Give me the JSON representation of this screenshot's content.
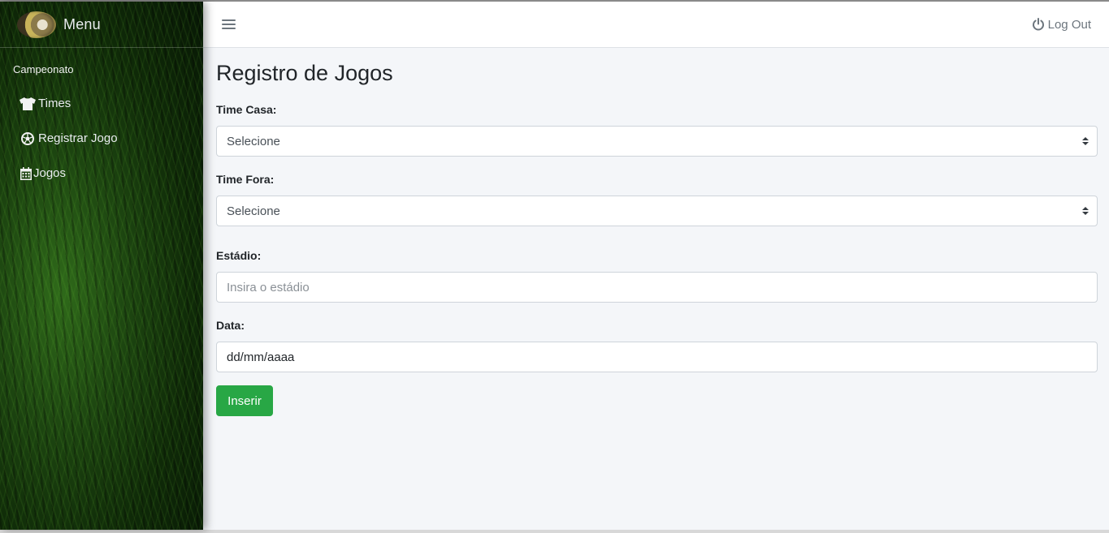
{
  "brand": {
    "title": "Menu"
  },
  "sidebar": {
    "header": "Campeonato",
    "items": [
      {
        "label": "Times",
        "icon": "tshirt-icon"
      },
      {
        "label": "Registrar Jogo",
        "icon": "futbol-icon"
      },
      {
        "label": "Jogos",
        "icon": "calendar-icon"
      }
    ]
  },
  "topbar": {
    "logout_label": "Log Out"
  },
  "page": {
    "title": "Registro de Jogos",
    "time_casa_label": "Time Casa:",
    "time_casa_value": "Selecione",
    "time_fora_label": "Time Fora:",
    "time_fora_value": "Selecione",
    "estadio_label": "Estádio:",
    "estadio_placeholder": "Insira o estádio",
    "data_label": "Data:",
    "data_value": "dd/mm/aaaa",
    "submit_label": "Inserir"
  },
  "colors": {
    "submit_button": "#28a745",
    "content_background": "#f4f6f9",
    "sidebar_grass": "#1c4410"
  }
}
